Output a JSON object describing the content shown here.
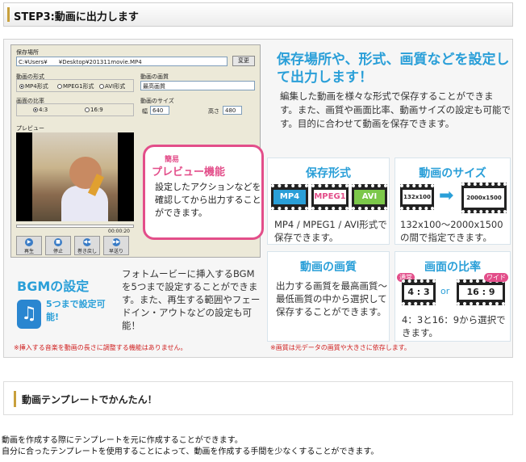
{
  "step_title": "STEP3:動画に出力します",
  "software": {
    "save_location_label": "保存場所",
    "save_path": "C:¥Users¥　　¥Desktop¥201311movie.MP4",
    "change_button": "変更",
    "format_label": "動画の形式",
    "formats": [
      "MP4形式",
      "MPEG1形式",
      "AVI形式"
    ],
    "quality_label": "動画の画質",
    "quality_value": "最高画質",
    "aspect_label": "画面の比率",
    "aspects": [
      "4:3",
      "16:9"
    ],
    "size_label": "動画のサイズ",
    "width_label": "幅",
    "width_value": "640",
    "height_label": "高さ",
    "height_value": "480",
    "preview_label": "プレビュー",
    "time": "00:00:20",
    "controls": [
      "再生",
      "停止",
      "巻き戻し",
      "早送り"
    ]
  },
  "preview_callout": {
    "small": "簡易",
    "title": "プレビュー機能",
    "body": "設定したアクションなどを確認してから出力することができます。"
  },
  "headline": "保存場所や、形式、画質などを設定して出力します！",
  "description": "編集した動画を様々な形式で保存することができます。また、画質や画面比率、動画サイズの設定も可能です。目的に合わせて動画を保存できます。",
  "cards": {
    "format": {
      "title": "保存形式",
      "items": [
        "MP4",
        "MPEG1",
        "AVI"
      ],
      "body": "MP4 / MPEG1 / AVI形式で保存できます。"
    },
    "size": {
      "title": "動画のサイズ",
      "from": "132x100",
      "to": "2000x1500",
      "body": "132x100～2000x1500の間で指定できます。"
    },
    "quality": {
      "title": "動画の画質",
      "body": "出力する画質を最高画質～最低画質の中から選択して保存することができます。"
    },
    "aspect": {
      "title": "画面の比率",
      "tag_left": "通常",
      "tag_right": "ワイド",
      "left": "4 : 3",
      "or": "or",
      "right": "16 : 9",
      "body": "4：3と16：9から選択できます。"
    }
  },
  "bgm": {
    "title": "BGMの設定",
    "badge": "5つまで設定可能!",
    "body": "フォトムービーに挿入するBGMを5つまで設定することができます。また、再生する範囲やフェードイン・アウトなどの設定も可能！"
  },
  "notes": {
    "bgm": "※挿入する音楽を動画の長さに調整する機能はありません。",
    "quality": "※画質は元データの画質や大きさに依存します。"
  },
  "template_title": "動画テンプレートでかんたん！",
  "paragraph": [
    "動画を作成する際にテンプレートを元に作成することができます。",
    "自分に合ったテンプレートを使用することによって、動画を作成する手間を少なくすることができます。"
  ],
  "colors": {
    "accent_blue": "#2a9fd8",
    "accent_pink": "#e34e8a",
    "gold": "#c8a03c"
  }
}
